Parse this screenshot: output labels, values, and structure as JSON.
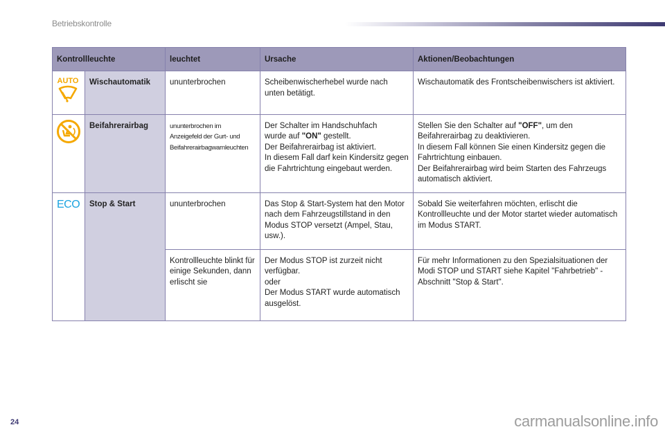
{
  "header": {
    "section_title": "Betriebskontrolle"
  },
  "table": {
    "columns": [
      "Kontrollleuchte",
      "leuchtet",
      "Ursache",
      "Aktionen/Beobachtungen"
    ],
    "rows": [
      {
        "icon": "auto-wiper-icon",
        "icon_label": "AUTO",
        "icon_color": "#f5a800",
        "name": "Wischautomatik",
        "lit": "ununterbrochen",
        "cause": [
          "Scheibenwischerhebel wurde nach unten betätigt."
        ],
        "action": [
          "Wischautomatik des Frontscheibenwischers ist aktiviert."
        ]
      },
      {
        "icon": "passenger-airbag-off-icon",
        "icon_color": "#f5a800",
        "name": "Beifahrerairbag",
        "lit": [
          "ununterbrochen im",
          "Anzeigefeld der Gurt- und",
          "Beifahrerairbagwarnleuchten"
        ],
        "cause": {
          "l1_pre": "Der Schalter im Handschuhfach",
          "l2_pre": "wurde auf ",
          "l2_bold": "\"ON\"",
          "l2_post": " gestellt.",
          "l3": "Der Beifahrerairbag ist aktiviert.",
          "l4": "In diesem Fall darf kein Kindersitz gegen die Fahrtrichtung eingebaut werden."
        },
        "action": {
          "l1_pre": "Stellen Sie den Schalter auf ",
          "l1_bold": "\"OFF\"",
          "l1_post": ", um den Beifahrerairbag zu deaktivieren.",
          "l2": "In diesem Fall können Sie einen Kindersitz gegen die Fahrtrichtung einbauen.",
          "l3": "Der Beifahrerairbag wird beim Starten des Fahrzeugs automatisch aktiviert."
        }
      },
      {
        "icon": "eco-icon",
        "icon_label": "ECO",
        "icon_color": "#1aa3e0",
        "name": "Stop & Start",
        "subrows": [
          {
            "lit": "ununterbrochen",
            "cause": [
              "Das Stop & Start-System hat den Motor nach dem Fahrzeugstillstand in den Modus STOP versetzt (Ampel, Stau, usw.)."
            ],
            "action": [
              "Sobald Sie weiterfahren möchten, erlischt die Kontrollleuchte und der Motor startet wieder automatisch im Modus START."
            ]
          },
          {
            "lit": "Kontrollleuchte blinkt für einige Sekunden, dann erlischt sie",
            "cause": [
              "Der Modus STOP ist zurzeit nicht verfügbar.",
              "oder",
              "Der Modus START wurde automatisch ausgelöst."
            ],
            "action": [
              "Für mehr Informationen zu den Spezialsituationen der Modi STOP und START siehe Kapitel \"Fahrbetrieb\" - Abschnitt \"Stop & Start\"."
            ]
          }
        ]
      }
    ]
  },
  "footer": {
    "page_number": "24",
    "watermark": "carmanualsonline.info"
  },
  "colors": {
    "header_bg": "#9d99b9",
    "name_col_bg": "#d0cfe0",
    "border": "#8580ac",
    "accent": "#3f3a74"
  }
}
